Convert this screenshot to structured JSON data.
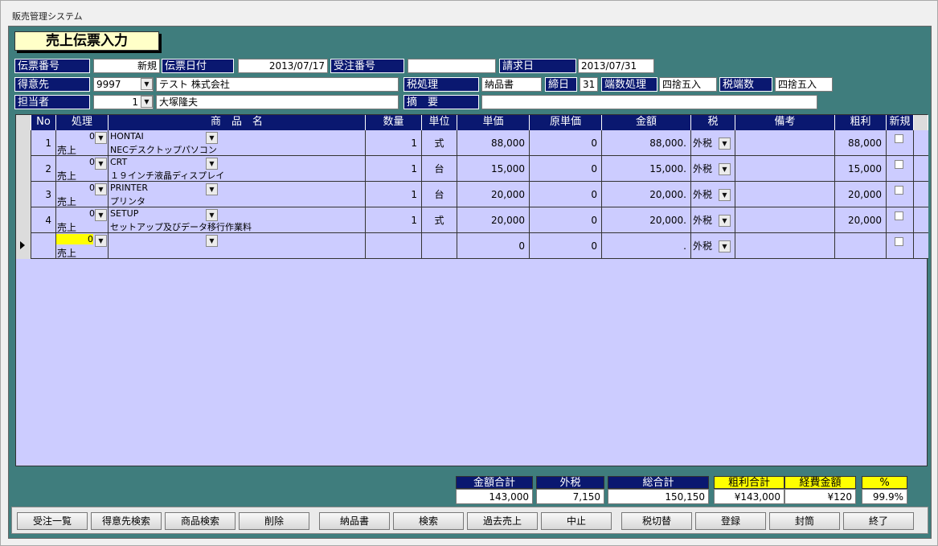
{
  "window": {
    "title": "販売管理システム"
  },
  "form": {
    "title": "売上伝票入力"
  },
  "header": {
    "slip_no_label": "伝票番号",
    "slip_no": "新規",
    "slip_date_label": "伝票日付",
    "slip_date": "2013/07/17",
    "order_no_label": "受注番号",
    "order_no": "",
    "bill_date_label": "請求日",
    "bill_date": "2013/07/31",
    "customer_label": "得意先",
    "customer_code": "9997",
    "customer_name": "テスト 株式会社",
    "tax_proc_label": "税処理",
    "tax_proc": "納品書",
    "closing_label": "締日",
    "closing": "31",
    "rounding_label": "端数処理",
    "rounding": "四捨五入",
    "tax_round_label": "税端数",
    "tax_round": "四捨五入",
    "staff_label": "担当者",
    "staff_code": "1",
    "staff_name": "大塚隆夫",
    "summary_label": "摘　要",
    "summary": ""
  },
  "grid": {
    "headers": [
      "No",
      "処理",
      "商　品　名",
      "数量",
      "単位",
      "単価",
      "原単価",
      "金額",
      "税",
      "備考",
      "粗利",
      "新規"
    ],
    "rows": [
      {
        "no": "1",
        "proc_code": "0",
        "proc": "売上",
        "code": "HONTAI",
        "name": "NECデスクトップパソコン",
        "qty": "1",
        "unit": "式",
        "price": "88,000",
        "cost": "0",
        "amount": "88,000.",
        "tax": "外税",
        "note": "",
        "profit": "88,000"
      },
      {
        "no": "2",
        "proc_code": "0",
        "proc": "売上",
        "code": "CRT",
        "name": "１９インチ液晶ディスプレイ",
        "qty": "1",
        "unit": "台",
        "price": "15,000",
        "cost": "0",
        "amount": "15,000.",
        "tax": "外税",
        "note": "",
        "profit": "15,000"
      },
      {
        "no": "3",
        "proc_code": "0",
        "proc": "売上",
        "code": "PRINTER",
        "name": "プリンタ",
        "qty": "1",
        "unit": "台",
        "price": "20,000",
        "cost": "0",
        "amount": "20,000.",
        "tax": "外税",
        "note": "",
        "profit": "20,000"
      },
      {
        "no": "4",
        "proc_code": "0",
        "proc": "売上",
        "code": "SETUP",
        "name": "セットアップ及びデータ移行作業料",
        "qty": "1",
        "unit": "式",
        "price": "20,000",
        "cost": "0",
        "amount": "20,000.",
        "tax": "外税",
        "note": "",
        "profit": "20,000"
      },
      {
        "no": "",
        "proc_code": "0",
        "proc": "売上",
        "code": "",
        "name": "",
        "qty": "",
        "unit": "",
        "price": "0",
        "cost": "0",
        "amount": ".",
        "tax": "外税",
        "note": "",
        "profit": ""
      }
    ]
  },
  "totals": {
    "amount_total_label": "金額合計",
    "amount_total": "143,000",
    "ext_tax_label": "外税",
    "ext_tax": "7,150",
    "grand_total_label": "総合計",
    "grand_total": "150,150",
    "profit_total_label": "粗利合計",
    "profit_total": "¥143,000",
    "expense_label": "経費金額",
    "expense": "¥120",
    "pct_label": "%",
    "pct": "99.9%"
  },
  "buttons": [
    "受注一覧",
    "得意先検索",
    "商品検索",
    "削除",
    "納品書",
    "検索",
    "過去売上",
    "中止",
    "税切替",
    "登録",
    "封筒",
    "終了"
  ],
  "colors": {
    "panel": "#3f7d7d",
    "label_bg": "#0a1870",
    "grid_bg": "#ccccff",
    "title_bg": "#ffffc8",
    "highlight": "#ffff00"
  }
}
